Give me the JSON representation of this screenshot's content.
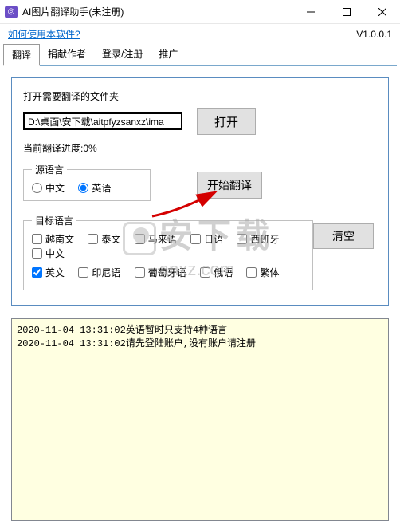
{
  "titlebar": {
    "title": "AI图片翻译助手(未注册)"
  },
  "header": {
    "help_link": "如何使用本软件?",
    "version": "V1.0.0.1"
  },
  "tabs": {
    "t0": "翻译",
    "t1": "捐献作者",
    "t2": "登录/注册",
    "t3": "推广"
  },
  "main": {
    "open_label": "打开需要翻译的文件夹",
    "path_value": "D:\\桌面\\安下载\\aitpfyzsanxz\\ima",
    "open_btn": "打开",
    "progress_label": "当前翻译进度:0%",
    "start_btn": "开始翻译",
    "clear_btn": "清空"
  },
  "source": {
    "legend": "源语言",
    "opt_zh": "中文",
    "opt_en": "英语"
  },
  "target": {
    "legend": "目标语言",
    "r1": {
      "vi": "越南文",
      "th": "泰文",
      "ms": "马来语",
      "ja": "日语",
      "es": "西班牙",
      "zh": "中文"
    },
    "r2": {
      "en": "英文",
      "id": "印尼语",
      "pt": "葡萄牙语",
      "ru": "俄语",
      "zht": "繁体"
    }
  },
  "log": "2020-11-04 13:31:02英语暂时只支持4种语言\n2020-11-04 13:31:02请先登陆账户,没有账户请注册",
  "watermark": {
    "text": "安下载",
    "domain": "anxz.com"
  }
}
